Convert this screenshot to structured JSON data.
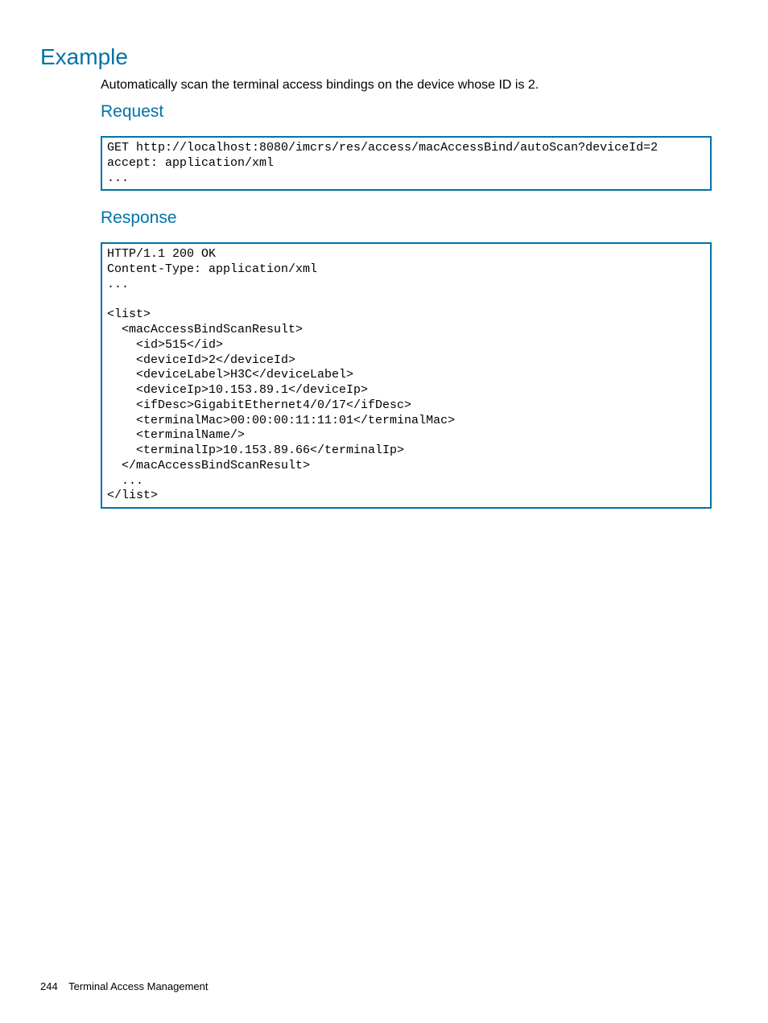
{
  "headings": {
    "example": "Example",
    "request": "Request",
    "response": "Response"
  },
  "intro": "Automatically scan the terminal access bindings on the device whose ID is 2.",
  "requestCode": "GET http://localhost:8080/imcrs/res/access/macAccessBind/autoScan?deviceId=2\naccept: application/xml\n...",
  "responseCode": "HTTP/1.1 200 OK\nContent-Type: application/xml\n...\n\n<list>\n  <macAccessBindScanResult>\n    <id>515</id>\n    <deviceId>2</deviceId>\n    <deviceLabel>H3C</deviceLabel>\n    <deviceIp>10.153.89.1</deviceIp>\n    <ifDesc>GigabitEthernet4/0/17</ifDesc>\n    <terminalMac>00:00:00:11:11:01</terminalMac>\n    <terminalName/>\n    <terminalIp>10.153.89.66</terminalIp>\n  </macAccessBindScanResult>\n  ...\n</list>",
  "footer": {
    "pageNumber": "244",
    "chapter": "Terminal Access Management"
  }
}
